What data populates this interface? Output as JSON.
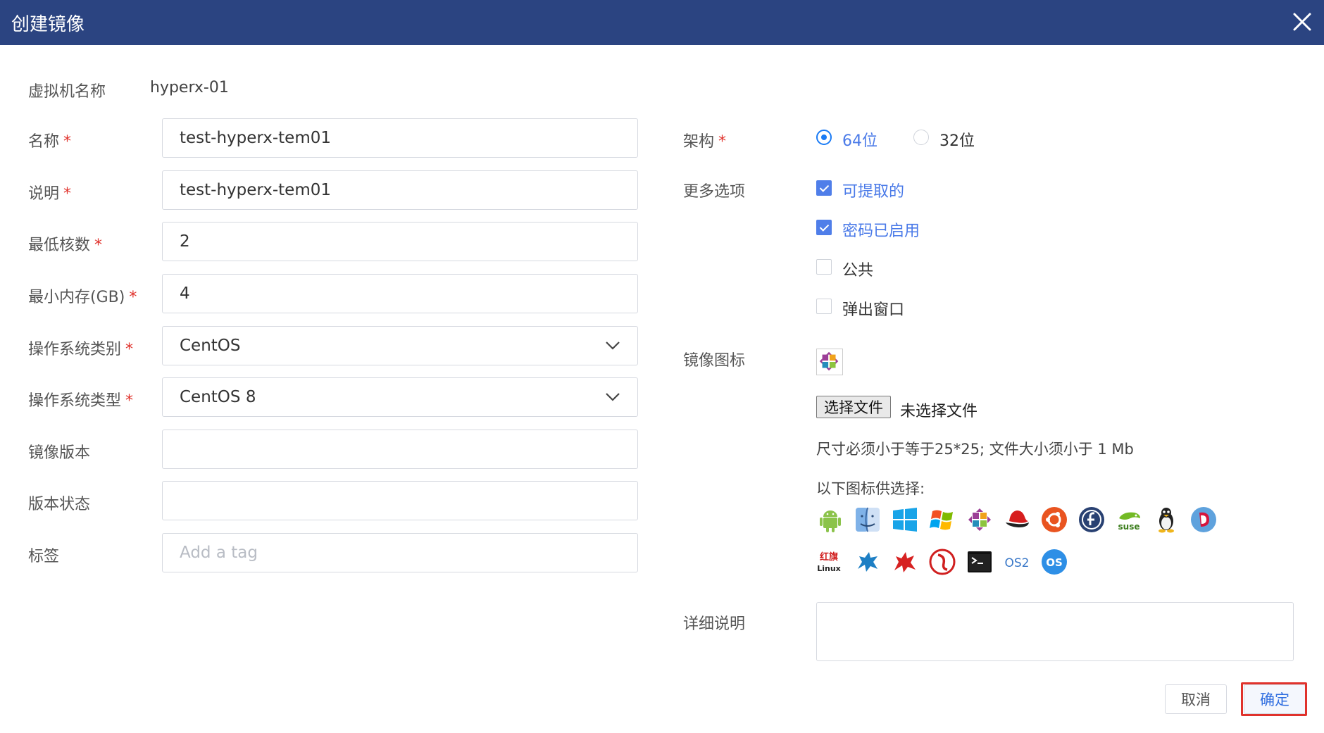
{
  "dialog": {
    "title": "创建镜像"
  },
  "vm": {
    "label": "虚拟机名称",
    "value": "hyperx-01"
  },
  "form": {
    "required_mark": "*",
    "name": {
      "label": "名称",
      "value": "test-hyperx-tem01"
    },
    "description": {
      "label": "说明",
      "value": "test-hyperx-tem01"
    },
    "min_cores": {
      "label": "最低核数",
      "value": "2"
    },
    "min_memory": {
      "label": "最小内存(GB)",
      "value": "4"
    },
    "os_category": {
      "label": "操作系统类别",
      "value": "CentOS"
    },
    "os_type": {
      "label": "操作系统类型",
      "value": "CentOS 8"
    },
    "image_version": {
      "label": "镜像版本",
      "value": ""
    },
    "version_status": {
      "label": "版本状态",
      "value": ""
    },
    "tags": {
      "label": "标签",
      "placeholder": "Add a tag"
    }
  },
  "arch": {
    "label": "架构",
    "options": [
      {
        "label": "64位",
        "selected": true
      },
      {
        "label": "32位",
        "selected": false
      }
    ]
  },
  "more_options": {
    "label": "更多选项",
    "items": [
      {
        "label": "可提取的",
        "checked": true
      },
      {
        "label": "密码已启用",
        "checked": true
      },
      {
        "label": "公共",
        "checked": false
      },
      {
        "label": "弹出窗口",
        "checked": false
      }
    ]
  },
  "image_icon": {
    "label": "镜像图标",
    "current_icon": "centos-icon",
    "file_button": "选择文件",
    "no_file_text": "未选择文件",
    "size_hint": "尺寸必须小于等于25*25; 文件大小须小于 1 Mb",
    "choose_hint": "以下图标供选择:",
    "icons_row1": [
      "android-icon",
      "macos-finder-icon",
      "windows-10-icon",
      "windows-xp-icon",
      "centos-icon",
      "redhat-icon",
      "ubuntu-icon",
      "fedora-icon",
      "suse-icon",
      "linux-tux-icon",
      "debian-icon"
    ],
    "icons_row2": [
      "redflag-linux-icon",
      "kylin-icon",
      "qilin-icon",
      "deepin-icon",
      "terminal-icon",
      "os2-icon",
      "os-icon"
    ],
    "icon_texts": {
      "redflag_top": "红旗",
      "redflag_bottom": "Linux",
      "os2": "OS2",
      "os": "OS",
      "suse": "suse"
    }
  },
  "details": {
    "label": "详细说明",
    "value": ""
  },
  "buttons": {
    "cancel": "取消",
    "ok": "确定"
  },
  "colors": {
    "header": "#2b4481",
    "accent": "#1a7bf5",
    "checkbox": "#4f7ee9",
    "required": "#e0322c"
  }
}
